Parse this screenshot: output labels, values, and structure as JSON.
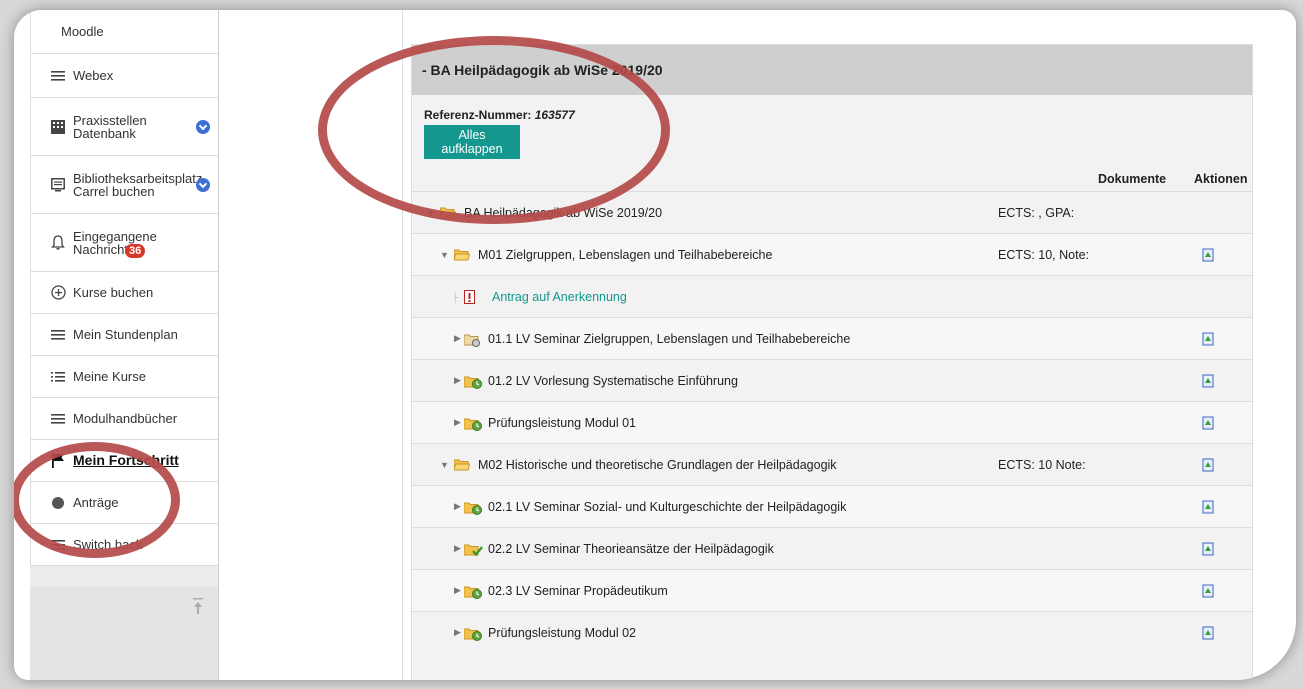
{
  "sidebar": {
    "items": [
      {
        "label": "Moodle",
        "icon": "moodle-icon"
      },
      {
        "label": "Webex",
        "icon": "menu-icon"
      },
      {
        "label": "Praxisstellen Datenbank",
        "icon": "building-icon"
      },
      {
        "label": "Bibliotheksarbeitsplatz Carrel buchen",
        "icon": "monitor-icon"
      },
      {
        "label": "Eingegangene Nachrichten",
        "icon": "bell-icon",
        "badge": "36"
      },
      {
        "label": "Kurse buchen",
        "icon": "plus-circle-icon"
      },
      {
        "label": "Mein Stundenplan",
        "icon": "menu-icon"
      },
      {
        "label": "Meine Kurse",
        "icon": "list-icon"
      },
      {
        "label": "Modulhandbücher",
        "icon": "menu-icon"
      },
      {
        "label": "Mein Fortschritt",
        "icon": "flag-icon"
      },
      {
        "label": "Anträge",
        "icon": "document-icon"
      },
      {
        "label": "Switch back",
        "icon": "menu-icon"
      }
    ]
  },
  "panel": {
    "title": "- BA Heilpädagogik ab WiSe 2019/20",
    "ref_label": "Referenz-Nummer:",
    "ref_value": "163577",
    "expand_button": "Alles aufklappen",
    "col_documents": "Dokumente",
    "col_actions": "Aktionen"
  },
  "rows": [
    {
      "text": "BA Heilpädagogik ab WiSe 2019/20",
      "ects": "ECTS: , GPA:",
      "icon": "folder-open-icon"
    },
    {
      "text": "M01 Zielgruppen, Lebenslagen und Teilhabebereiche",
      "ects": "ECTS: 10, Note:",
      "icon": "folder-open-icon"
    },
    {
      "text": "Antrag auf Anerkennung",
      "ects": "",
      "icon": "pdf-icon"
    },
    {
      "text": "01.1 LV Seminar Zielgruppen, Lebenslagen und Teilhabebereiche",
      "ects": "",
      "icon": "folder-anchor-icon"
    },
    {
      "text": "01.2 LV Vorlesung Systematische Einführung",
      "ects": "",
      "icon": "folder-clock-icon"
    },
    {
      "text": "Prüfungsleistung Modul 01",
      "ects": "",
      "icon": "folder-clock-icon"
    },
    {
      "text": "M02 Historische und theoretische Grundlagen der Heilpädagogik",
      "ects": "ECTS: 10 Note:",
      "icon": "folder-open-icon"
    },
    {
      "text": "02.1 LV Seminar Sozial- und Kulturgeschichte der Heilpädagogik",
      "ects": "",
      "icon": "folder-clock-icon"
    },
    {
      "text": "02.2 LV Seminar Theorieansätze der Heilpädagogik",
      "ects": "",
      "icon": "folder-check-icon"
    },
    {
      "text": "02.3 LV Seminar Propädeutikum",
      "ects": "",
      "icon": "folder-clock-icon"
    },
    {
      "text": "Prüfungsleistung Modul 02",
      "ects": "",
      "icon": "folder-clock-icon"
    }
  ],
  "colors": {
    "accent": "#14978f",
    "annotation": "#b44a4a",
    "badge": "#d9362b"
  }
}
